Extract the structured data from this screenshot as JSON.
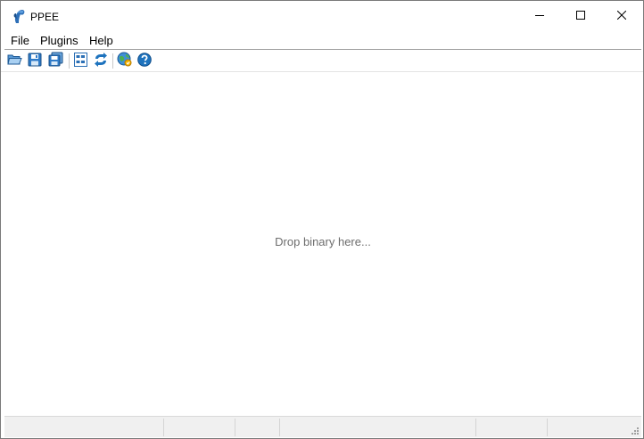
{
  "window": {
    "title": "PPEE",
    "caption_buttons": [
      "minimize-icon",
      "maximize-icon",
      "close-icon"
    ]
  },
  "menubar": {
    "items": [
      {
        "label": "File"
      },
      {
        "label": "Plugins"
      },
      {
        "label": "Help"
      }
    ]
  },
  "toolbar": {
    "buttons": [
      {
        "icon": "open-folder-icon"
      },
      {
        "icon": "save-icon"
      },
      {
        "icon": "save-all-icon"
      },
      {
        "icon": "hex-view-icon"
      },
      {
        "icon": "refresh-icon"
      },
      {
        "icon": "web-lookup-icon"
      },
      {
        "icon": "help-icon"
      }
    ]
  },
  "main": {
    "drop_hint": "Drop binary here..."
  },
  "statusbar": {
    "panes": [
      "",
      "",
      "",
      "",
      "",
      ""
    ]
  },
  "colors": {
    "hint_text": "#6d6d6d",
    "toolbar_blue": "#1e73be",
    "statusbar_bg": "#f0f0f0"
  }
}
